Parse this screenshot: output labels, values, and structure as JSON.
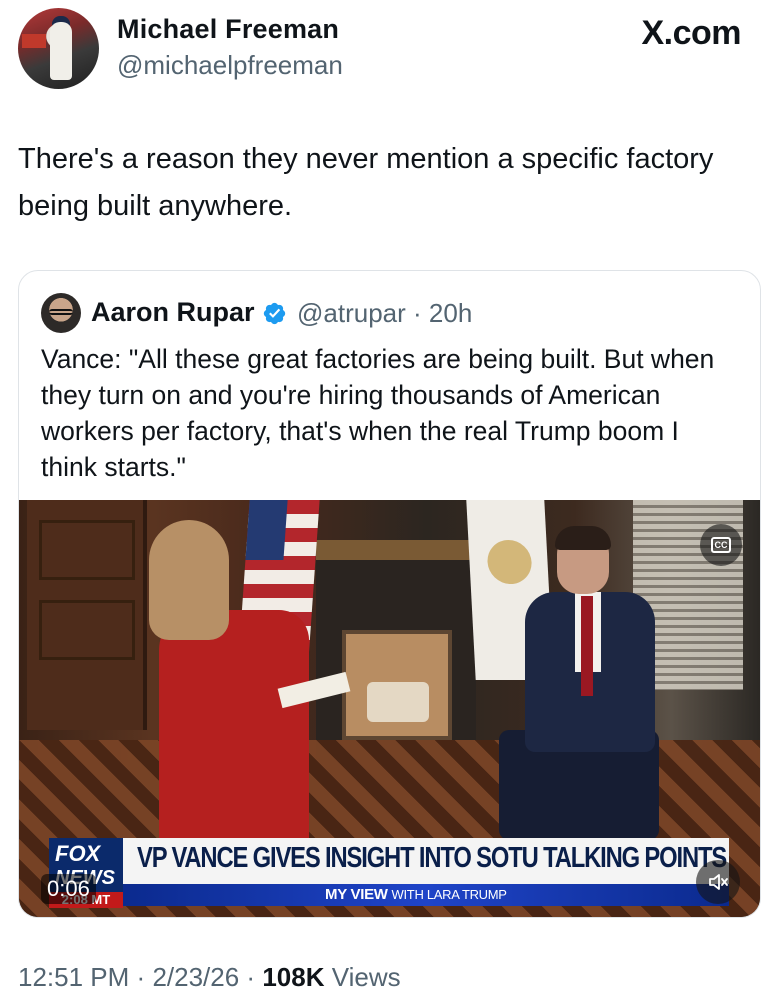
{
  "author": {
    "name": "Michael Freeman",
    "handle": "@michaelpfreeman"
  },
  "brand": "X.com",
  "tweet": {
    "text": "There's a reason they never mention a specific factory being built anywhere."
  },
  "quoted": {
    "name": "Aaron Rupar",
    "handle": "@atrupar",
    "separator": "·",
    "age": "20h",
    "text": "Vance: \"All these great factories are being built. But when they turn on and you're hiring thousands of American workers per factory, that's when the real Trump boom I think starts.\"",
    "video": {
      "elapsed": "0:06",
      "headline": "VP VANCE GIVES INSIGHT INTO SOTU TALKING POINTS",
      "network_line1": "FOX",
      "network_line2": "NEWS",
      "network_time": "2:08 MT",
      "show_name": "MY VIEW",
      "show_with": "WITH LARA TRUMP",
      "cc_label": "CC"
    }
  },
  "meta": {
    "time": "12:51 PM",
    "date": "2/23/26",
    "sep": "·",
    "views_count": "108K",
    "views_label": "Views"
  },
  "colors": {
    "text": "#0f1419",
    "secondary": "#536471",
    "verified": "#1d9bf0"
  }
}
